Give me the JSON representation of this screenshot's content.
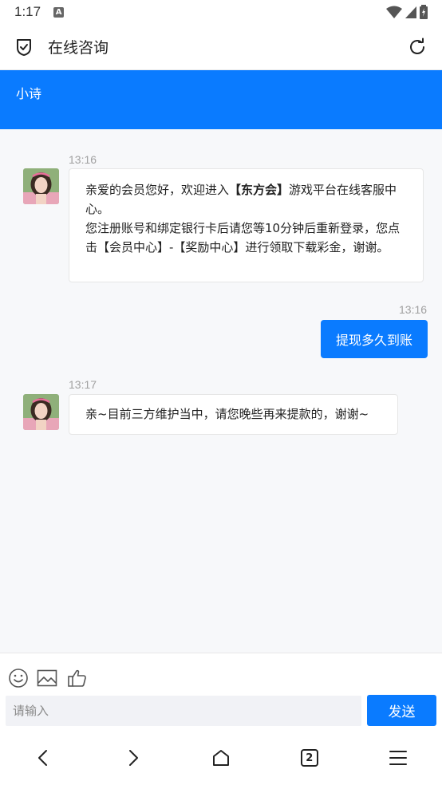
{
  "status_bar": {
    "time": "1:17",
    "notification_letter": "A"
  },
  "app_bar": {
    "title": "在线咨询"
  },
  "agent": {
    "name": "小诗"
  },
  "messages": [
    {
      "time": "13:16",
      "from": "agent",
      "text_before": "亲爱的会员您好，欢迎进入",
      "text_bold": "【东方会】",
      "text_after": "游戏平台在线客服中心。",
      "text_line2": "您注册账号和绑定银行卡后请您等10分钟后重新登录，您点击【会员中心】-【奖励中心】进行领取下载彩金，谢谢。"
    },
    {
      "time": "13:16",
      "from": "user",
      "text": "提现多久到账"
    },
    {
      "time": "13:17",
      "from": "agent",
      "text": "亲~目前三方维护当中，请您晚些再来提款的，谢谢~"
    }
  ],
  "composer": {
    "placeholder": "请输入",
    "send_label": "发送"
  },
  "browser_nav": {
    "tab_count": "2"
  },
  "colors": {
    "accent": "#0a7bff",
    "chat_bg": "#f7f8fa"
  }
}
